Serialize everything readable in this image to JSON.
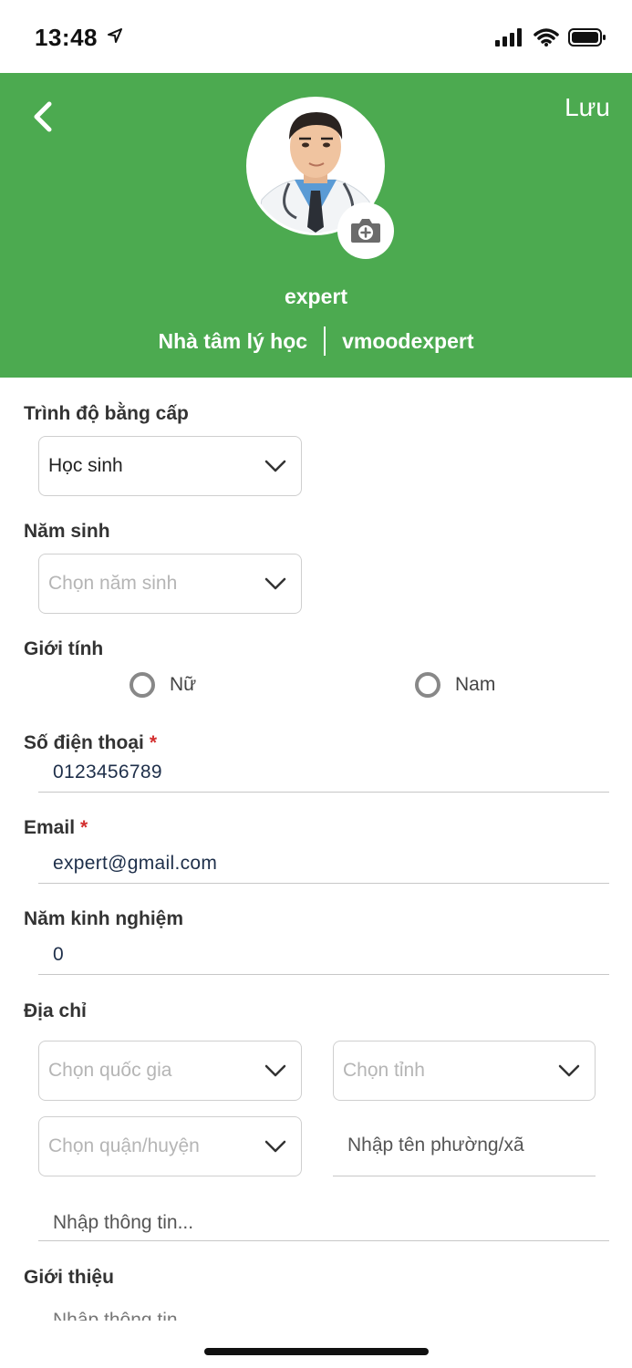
{
  "status_bar": {
    "time": "13:48",
    "icons": [
      "location-arrow-icon",
      "signal-icon",
      "wifi-icon",
      "battery-icon"
    ]
  },
  "header": {
    "background": "#4caa50",
    "back_icon": "chevron-left-icon",
    "save_label": "Lưu",
    "camera_icon": "camera-add-icon",
    "name": "expert",
    "role": "Nhà tâm lý học",
    "username": "vmoodexpert"
  },
  "form": {
    "education": {
      "label": "Trình độ bằng cấp",
      "value": "Học sinh"
    },
    "birth_year": {
      "label": "Năm sinh",
      "placeholder": "Chọn năm sinh"
    },
    "gender": {
      "label": "Giới tính",
      "options": [
        "Nữ",
        "Nam"
      ]
    },
    "phone": {
      "label": "Số điện thoại",
      "required_mark": "*",
      "value": "0123456789"
    },
    "email": {
      "label": "Email",
      "required_mark": "*",
      "value": "expert@gmail.com"
    },
    "experience": {
      "label": "Năm kinh nghiệm",
      "value": "0"
    },
    "address": {
      "label": "Địa chỉ",
      "country_placeholder": "Chọn quốc gia",
      "province_placeholder": "Chọn tỉnh",
      "district_placeholder": "Chọn quận/huyện",
      "ward_placeholder": "Nhập tên phường/xã",
      "detail_placeholder": "Nhập thông tin..."
    },
    "intro": {
      "label": "Giới thiệu",
      "placeholder": "Nhập thông tin..."
    }
  }
}
